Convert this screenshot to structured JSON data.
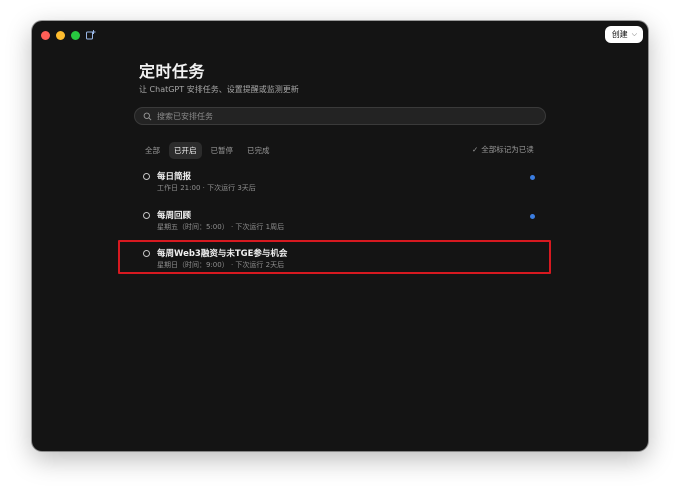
{
  "window": {
    "create_label": "创建"
  },
  "header": {
    "title": "定时任务",
    "subtitle": "让 ChatGPT 安排任务、设置提醒或监测更新"
  },
  "search": {
    "placeholder": "搜索已安排任务"
  },
  "filters": {
    "tabs": [
      {
        "label": "全部",
        "active": false
      },
      {
        "label": "已开启",
        "active": true
      },
      {
        "label": "已暂停",
        "active": false
      },
      {
        "label": "已完成",
        "active": false
      }
    ],
    "mark_all_read": "全部标记为已读"
  },
  "tasks": [
    {
      "name": "每日简报",
      "schedule": "工作日 21:00",
      "next_run": "下次运行 3天后",
      "unread": true
    },
    {
      "name": "每周回顾",
      "schedule": "星期五（时间：5:00）",
      "next_run": "下次运行 1周后",
      "unread": true
    },
    {
      "name": "每周Web3融资与未TGE参与机会",
      "schedule": "星期日（时间：9:00）",
      "next_run": "下次运行 2天后",
      "unread": false
    }
  ],
  "colors": {
    "window_bg": "#141414",
    "unread_dot": "#3b7de0",
    "highlight": "#d71920"
  }
}
